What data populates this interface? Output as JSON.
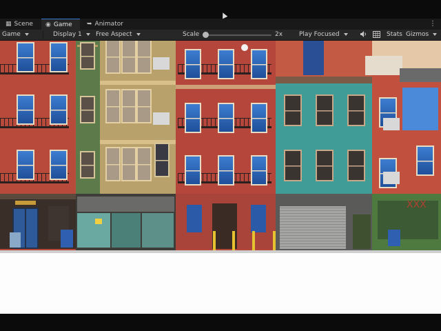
{
  "editor": {
    "tabs": [
      {
        "label": "Scene",
        "icon": "scene-grid-icon"
      },
      {
        "label": "Game",
        "icon": "gamepad-icon"
      },
      {
        "label": "Animator",
        "icon": "animator-icon"
      }
    ],
    "more_icon": "kebab-menu-icon"
  },
  "toolbar": {
    "view_mode": "Game",
    "display": "Display 1",
    "aspect": "Free Aspect",
    "scale_label": "Scale",
    "scale_value": "2x",
    "scale_fraction": 0.0,
    "play_mode": "Play Focused",
    "audio_icon": "speaker-icon",
    "stats_icon": "grid-icon",
    "stats_label": "Stats",
    "gizmos_label": "Gizmos"
  },
  "colors": {
    "accent": "#3a7bd5",
    "panel": "#272727",
    "sky": "#fdfdfd"
  }
}
